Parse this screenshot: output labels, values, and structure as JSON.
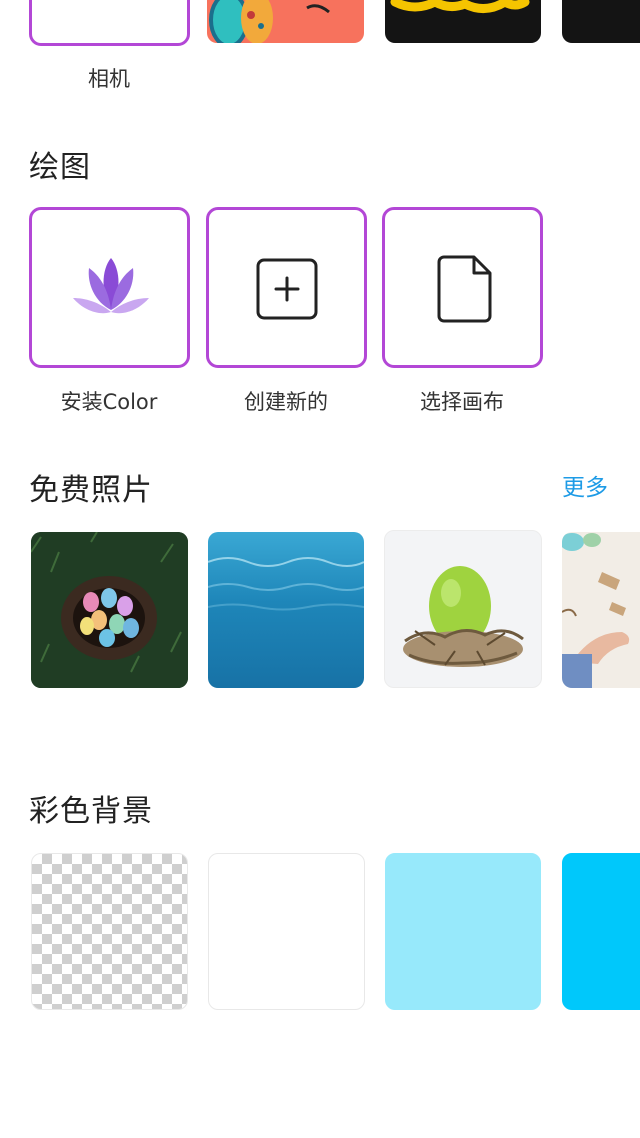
{
  "top_row": {
    "camera_label": "相机"
  },
  "drawing": {
    "title": "绘图",
    "items": [
      {
        "label": "安装Color",
        "icon": "lotus-icon"
      },
      {
        "label": "创建新的",
        "icon": "plus-square-icon"
      },
      {
        "label": "选择画布",
        "icon": "document-icon"
      }
    ]
  },
  "free_photos": {
    "title": "免费照片",
    "more": "更多"
  },
  "color_backgrounds": {
    "title": "彩色背景",
    "colors": [
      "transparent",
      "#ffffff",
      "#97e9fb",
      "#00c8fb"
    ]
  },
  "colors": {
    "accent_purple": "#b347d6",
    "link_blue": "#1e9be6"
  }
}
